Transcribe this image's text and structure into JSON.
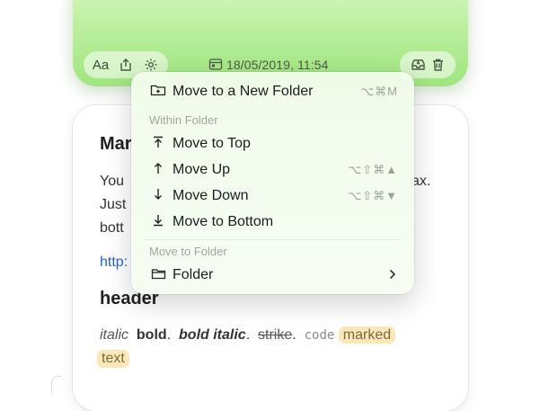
{
  "toolbar": {
    "format_label": "Aa",
    "date": "18/05/2019, 11:54"
  },
  "note": {
    "title": "Mar",
    "line1_start": "You",
    "line1_end": "ax.",
    "line2": "Just",
    "line3": "bott",
    "link": "http:",
    "header": "header",
    "fmt": {
      "italic": "italic",
      "bold": "bold",
      "bold_italic": "bold italic",
      "strike": "strike",
      "code": "code",
      "marked": "marked",
      "marked_cont": "text"
    }
  },
  "menu": {
    "new_folder": {
      "label": "Move to a New Folder",
      "shortcut": "⌥⌘M"
    },
    "section_within": "Within Folder",
    "top": {
      "label": "Move to Top"
    },
    "up": {
      "label": "Move Up",
      "shortcut": "⌥⇧⌘▲"
    },
    "down": {
      "label": "Move Down",
      "shortcut": "⌥⇧⌘▼"
    },
    "bottom": {
      "label": "Move to Bottom"
    },
    "section_move": "Move to Folder",
    "folder": {
      "label": "Folder"
    }
  },
  "colors": {
    "accent_green": "#9fe57f",
    "menu_bg": "#f1fcea",
    "link": "#2a62c9",
    "marked": "#fbe8b8"
  }
}
